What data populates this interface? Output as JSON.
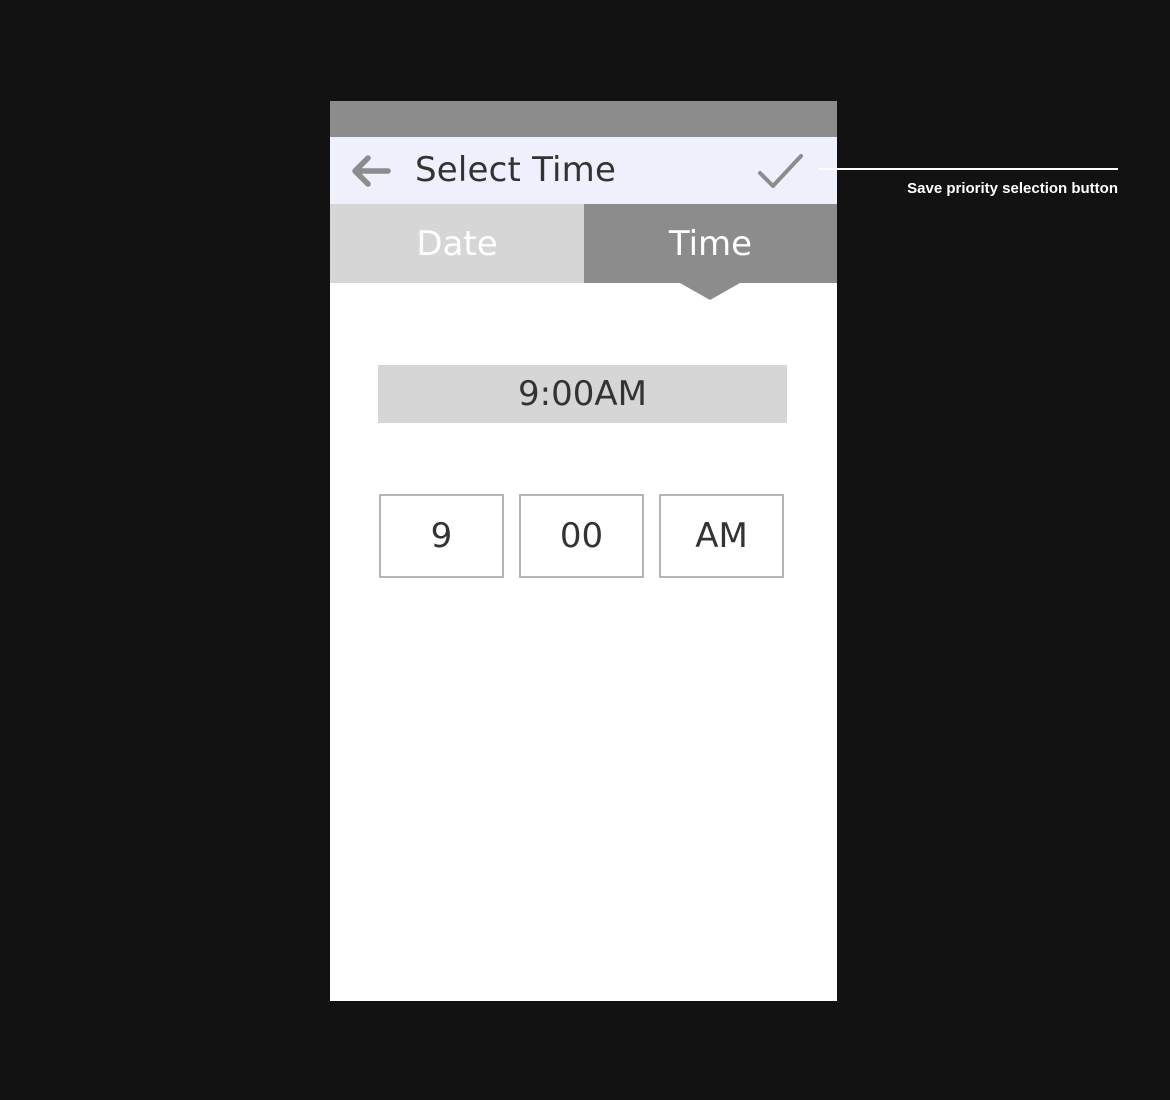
{
  "header": {
    "title": "Select Time",
    "back_icon": "arrow-left-icon",
    "save_icon": "checkmark-icon"
  },
  "tabs": [
    {
      "label": "Date",
      "selected": false
    },
    {
      "label": "Time",
      "selected": true
    }
  ],
  "time_display": {
    "value": "9:00AM"
  },
  "picker": {
    "hour": "9",
    "minute": "00",
    "period": "AM"
  },
  "annotation": {
    "label": "Save priority selection button"
  },
  "colors": {
    "background": "#121212",
    "status_bar": "#8c8c8c",
    "app_bar": "#eef0fb",
    "tab_inactive": "#d6d6d6",
    "tab_active": "#8c8c8c",
    "text": "#333333"
  }
}
